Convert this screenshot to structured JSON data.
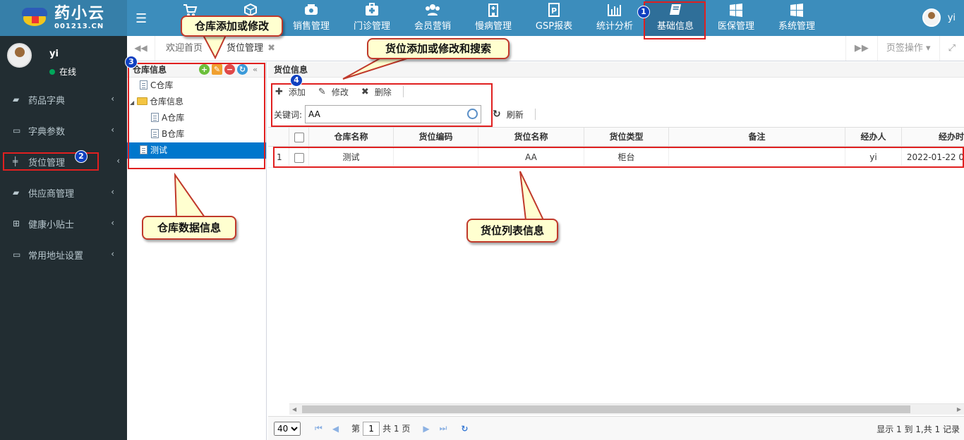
{
  "logo": {
    "name": "药小云",
    "domain": "001213.CN"
  },
  "topnav": [
    {
      "label": "采",
      "icon": "cart-icon"
    },
    {
      "label": "",
      "icon": "box-icon"
    },
    {
      "label": "销售管理",
      "icon": "phone-icon"
    },
    {
      "label": "门诊管理",
      "icon": "medkit-icon"
    },
    {
      "label": "会员营销",
      "icon": "users-icon"
    },
    {
      "label": "慢病管理",
      "icon": "hospital-icon"
    },
    {
      "label": "GSP报表",
      "icon": "gsp-icon"
    },
    {
      "label": "统计分析",
      "icon": "bar-chart-icon"
    },
    {
      "label": "基础信息",
      "icon": "book-icon"
    },
    {
      "label": "医保管理",
      "icon": "windows-icon"
    },
    {
      "label": "系统管理",
      "icon": "windows-icon"
    }
  ],
  "user": {
    "name": "yi",
    "status": "在线"
  },
  "sidebar": [
    {
      "label": "药品字典",
      "icon": "book-icon"
    },
    {
      "label": "字典参数",
      "icon": "monitor-icon"
    },
    {
      "label": "货位管理",
      "icon": "pin-icon"
    },
    {
      "label": "供应商管理",
      "icon": "truck-icon"
    },
    {
      "label": "健康小贴士",
      "icon": "medkit-icon"
    },
    {
      "label": "常用地址设置",
      "icon": "monitor-icon"
    }
  ],
  "tabs": {
    "home": "欢迎首页",
    "current": "货位管理",
    "close": "✖",
    "ops": "页签操作"
  },
  "tree": {
    "title": "仓库信息",
    "nodes": [
      "C仓库",
      "仓库信息",
      "A仓库",
      "B仓库",
      "测试"
    ]
  },
  "content": {
    "title": "货位信息",
    "add": "添加",
    "edit": "修改",
    "delete": "删除",
    "keyword_label": "关键词:",
    "keyword_value": "AA",
    "refresh": "刷新"
  },
  "grid": {
    "columns": [
      "仓库名称",
      "货位编码",
      "货位名称",
      "货位类型",
      "备注",
      "经办人",
      "经办时"
    ],
    "rows": [
      {
        "index": "1",
        "warehouse": "测试",
        "code": "",
        "name": "AA",
        "type": "柜台",
        "remark": "",
        "operator": "yi",
        "time": "2022-01-22 0"
      }
    ]
  },
  "pager": {
    "page_size": "40",
    "page_prefix": "第",
    "page": "1",
    "page_suffix": "共 1 页",
    "info": "显示 1 到 1,共 1 记录"
  },
  "annotations": {
    "badge1": "1",
    "badge2": "2",
    "badge3": "3",
    "badge4": "4",
    "callout_wh_edit": "仓库添加或修改",
    "callout_loc_edit": "货位添加或修改和搜索",
    "callout_wh_data": "仓库数据信息",
    "callout_loc_list": "货位列表信息"
  },
  "colors": {
    "header": "#3c8dbc",
    "sidebar": "#222d32",
    "highlight": "#e02020",
    "selected": "#0077cc"
  }
}
